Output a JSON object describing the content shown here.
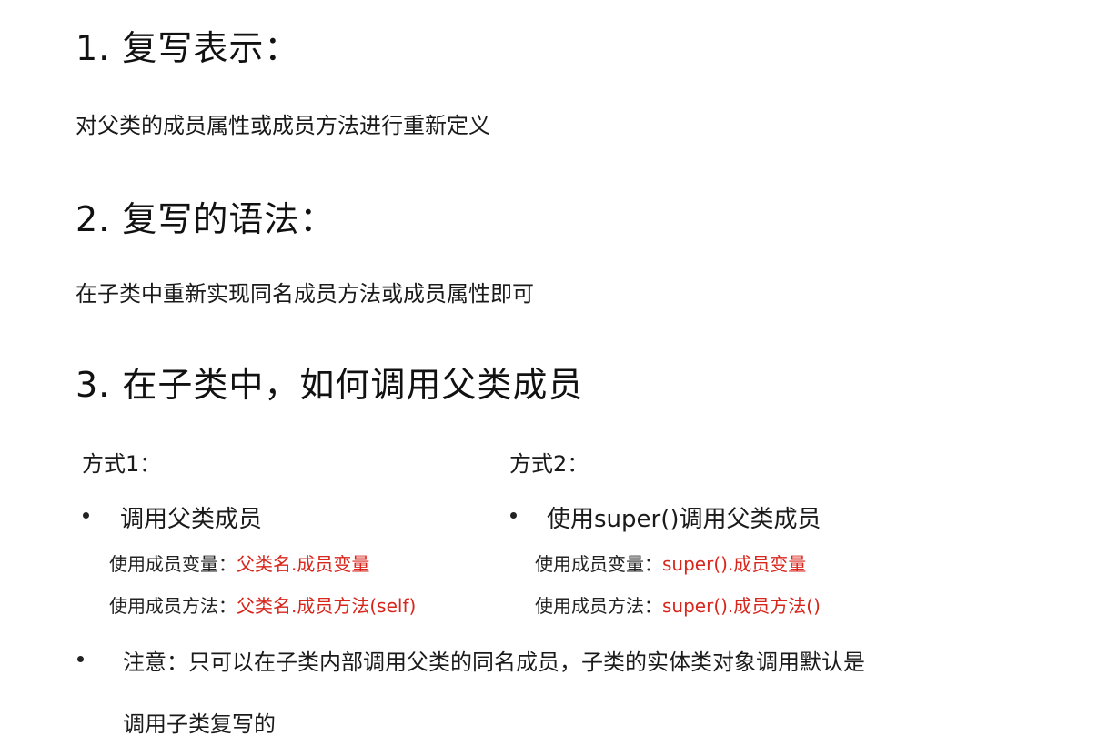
{
  "section1": {
    "heading": "1. 复写表示：",
    "text": "对父类的成员属性或成员方法进行重新定义"
  },
  "section2": {
    "heading": "2. 复写的语法：",
    "text": "在子类中重新实现同名成员方法或成员属性即可"
  },
  "section3": {
    "heading": "3. 在子类中，如何调用父类成员",
    "way1": {
      "title": "方式1：",
      "bullet": "调用父类成员",
      "var_label": "使用成员变量：",
      "var_code": "父类名.成员变量",
      "method_label": "使用成员方法：",
      "method_code": "父类名.成员方法(self)"
    },
    "way2": {
      "title": "方式2：",
      "bullet": "使用super()调用父类成员",
      "var_label": "使用成员变量：",
      "var_code": "super().成员变量",
      "method_label": "使用成员方法：",
      "method_code": "super().成员方法()"
    },
    "note_line1": "注意：只可以在子类内部调用父类的同名成员，子类的实体类对象调用默认是",
    "note_line2": "调用子类复写的"
  },
  "colors": {
    "highlight": "#d9261c",
    "text": "#1a1a1a"
  }
}
